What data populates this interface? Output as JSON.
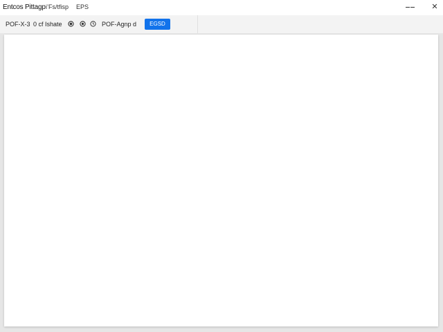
{
  "window": {
    "title": "Entcos Pittagp",
    "menu": [
      "i’Fs/tfisp",
      "EPS"
    ],
    "minimize_label": "––",
    "close_label": "✕"
  },
  "toolbar": {
    "page_indicator": "POF-X-3",
    "size_label": "0 cf Ishate",
    "mode_label": "POF-Agnp d",
    "primary_button_label": "EGSD",
    "icons": [
      "dot-circle-icon",
      "dot-circle-icon",
      "clock-icon"
    ]
  },
  "colors": {
    "accent": "#1273eb",
    "titlebar": "#ffffff",
    "toolbar": "#f3f3f3",
    "canvas": "#e6e6e6",
    "page": "#ffffff"
  }
}
